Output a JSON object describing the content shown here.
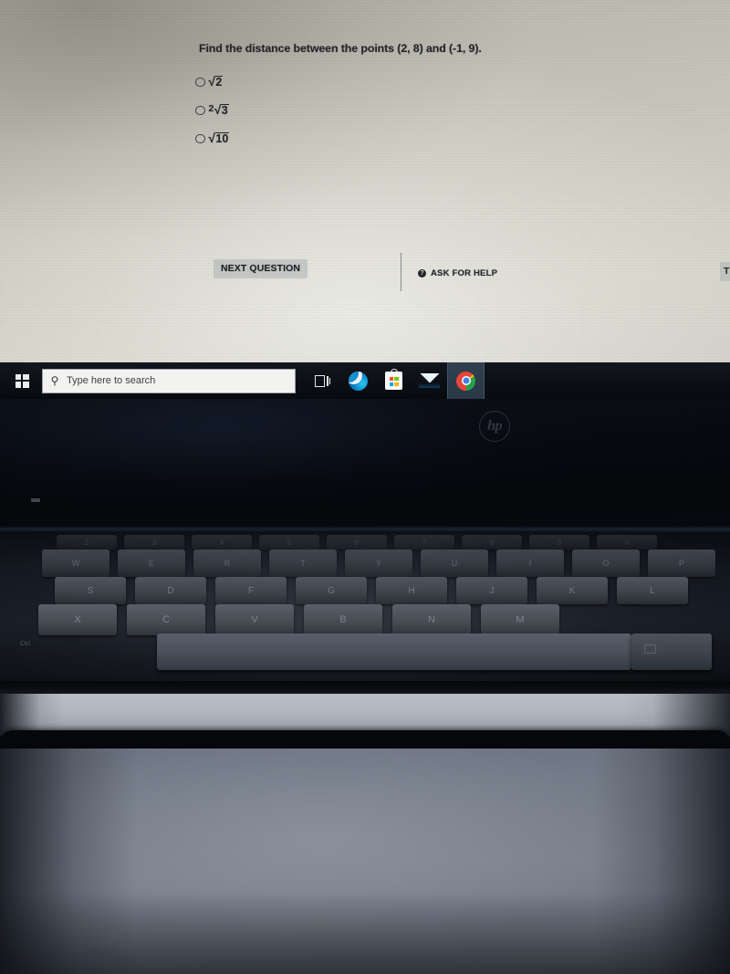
{
  "quiz": {
    "question": "Find the distance between the points (2, 8) and (-1, 9).",
    "options": [
      {
        "id": "a",
        "coefficient": "",
        "radicand": "2",
        "text": "√2",
        "selected": false
      },
      {
        "id": "b",
        "coefficient": "2",
        "radicand": "3",
        "text": "2√3",
        "selected": false
      },
      {
        "id": "c",
        "coefficient": "",
        "radicand": "10",
        "text": "√10",
        "selected": false
      }
    ],
    "next_question_label": "NEXT QUESTION",
    "ask_for_help_label": "ASK FOR HELP",
    "help_icon_glyph": "?",
    "cut_off_right_label": "TU"
  },
  "taskbar": {
    "start_icon": "windows-logo-icon",
    "search_placeholder": "Type here to search",
    "search_icon": "search-icon",
    "items": [
      {
        "name": "task-view",
        "label": "Task View",
        "active": false
      },
      {
        "name": "microsoft-edge",
        "label": "Microsoft Edge",
        "active": false
      },
      {
        "name": "microsoft-store",
        "label": "Microsoft Store",
        "active": false
      },
      {
        "name": "mail",
        "label": "Mail",
        "active": false
      },
      {
        "name": "google-chrome",
        "label": "Google Chrome",
        "active": true
      }
    ]
  },
  "device": {
    "brand_logo": "hp",
    "brand_logo_text": "hp",
    "keyboard_rows": [
      {
        "name": "number-row",
        "keys": [
          "2",
          "3",
          "4",
          "5",
          "6",
          "7",
          "8",
          "9",
          "0"
        ]
      },
      {
        "name": "qwerty-row",
        "keys": [
          "W",
          "E",
          "R",
          "T",
          "Y",
          "U",
          "I",
          "O",
          "P"
        ]
      },
      {
        "name": "home-row",
        "keys": [
          "S",
          "D",
          "F",
          "G",
          "H",
          "J",
          "K",
          "L"
        ]
      },
      {
        "name": "bottom-row",
        "keys": [
          "X",
          "C",
          "V",
          "B",
          "N",
          "M"
        ]
      }
    ],
    "ctrl_label": "Ctrl"
  },
  "colors": {
    "screen_base": "#c6c5bb",
    "taskbar": "#0d1117",
    "accent_active": "#31404f",
    "text_dark": "#22242a",
    "bezel": "#07090e",
    "desk": "#7d838f"
  }
}
